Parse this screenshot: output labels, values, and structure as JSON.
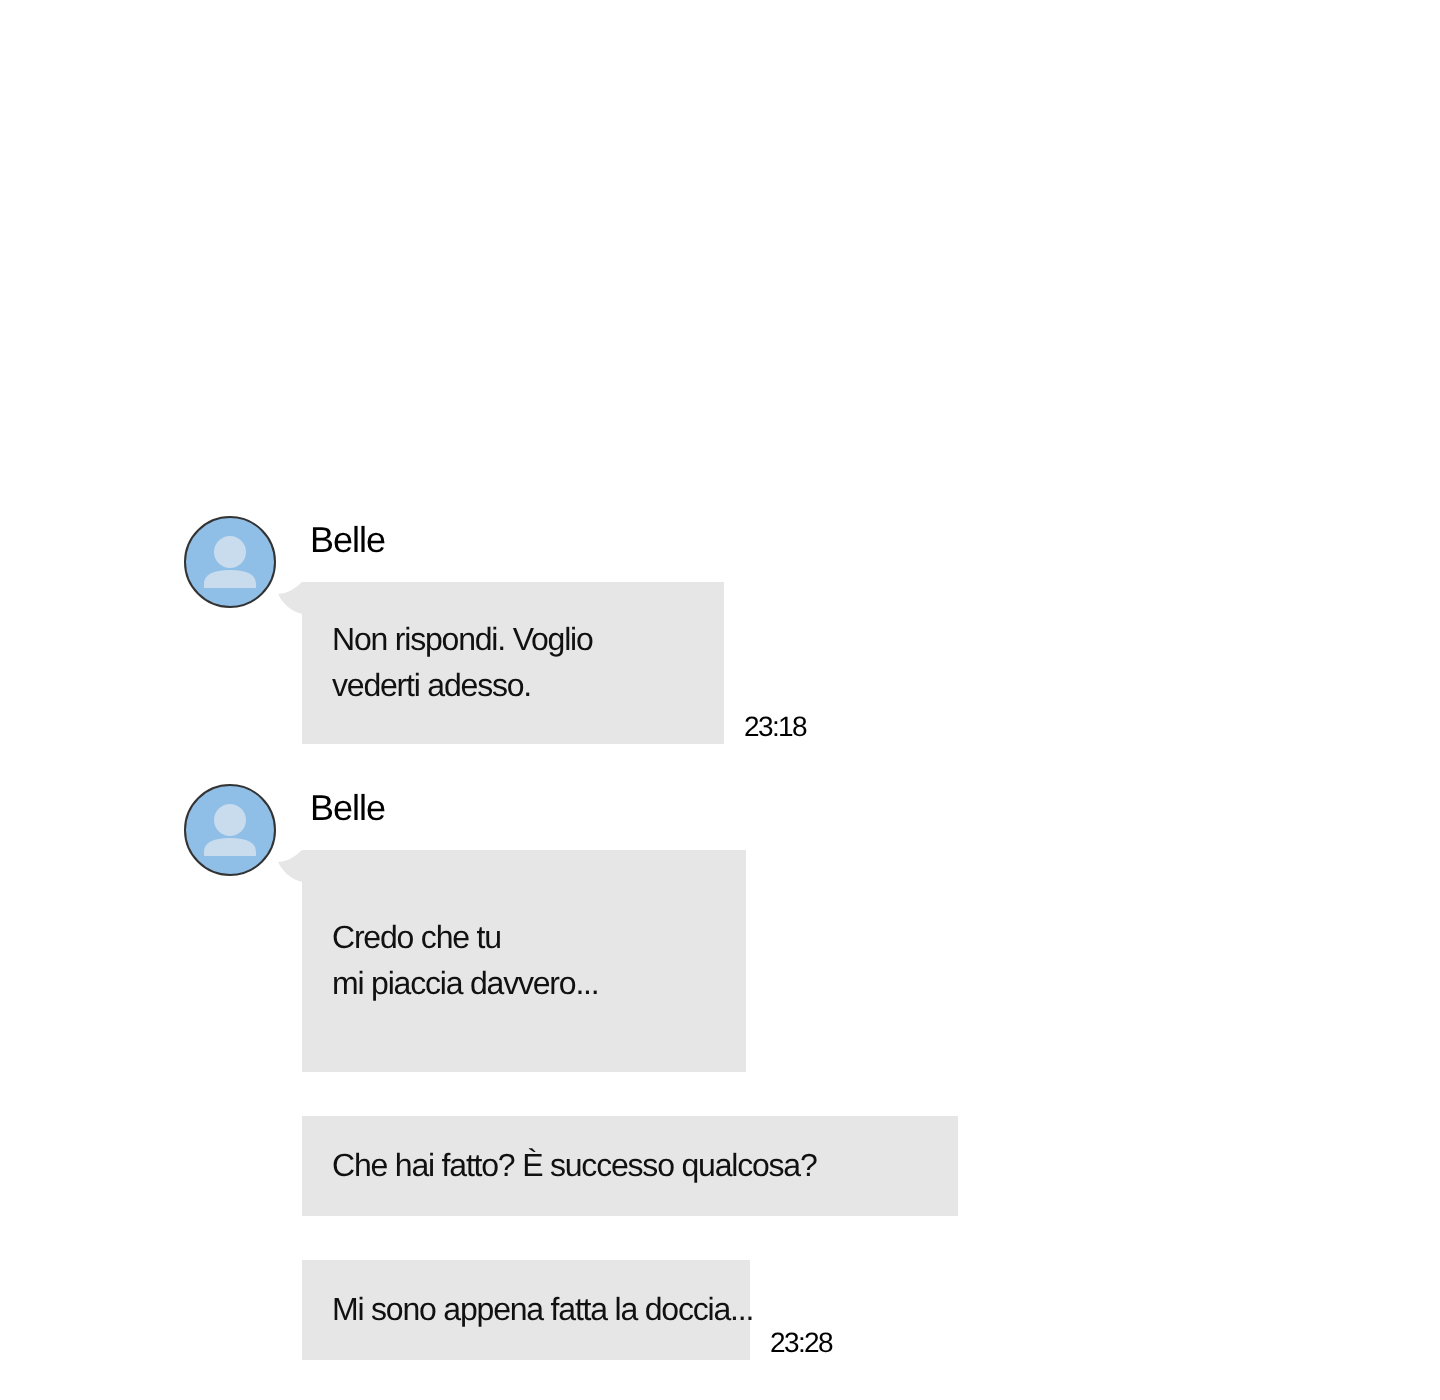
{
  "groups": [
    {
      "sender": "Belle",
      "messages": [
        {
          "text": "Non rispondi. Voglio\nvederti adesso.",
          "time": "23:18"
        }
      ]
    },
    {
      "sender": "Belle",
      "messages": [
        {
          "text": "Credo che tu\nmi piaccia davvero..."
        },
        {
          "text": "Che hai fatto? È successo qualcosa?"
        },
        {
          "text": "Mi sono appena fatta la doccia...",
          "time": "23:28"
        }
      ]
    }
  ]
}
